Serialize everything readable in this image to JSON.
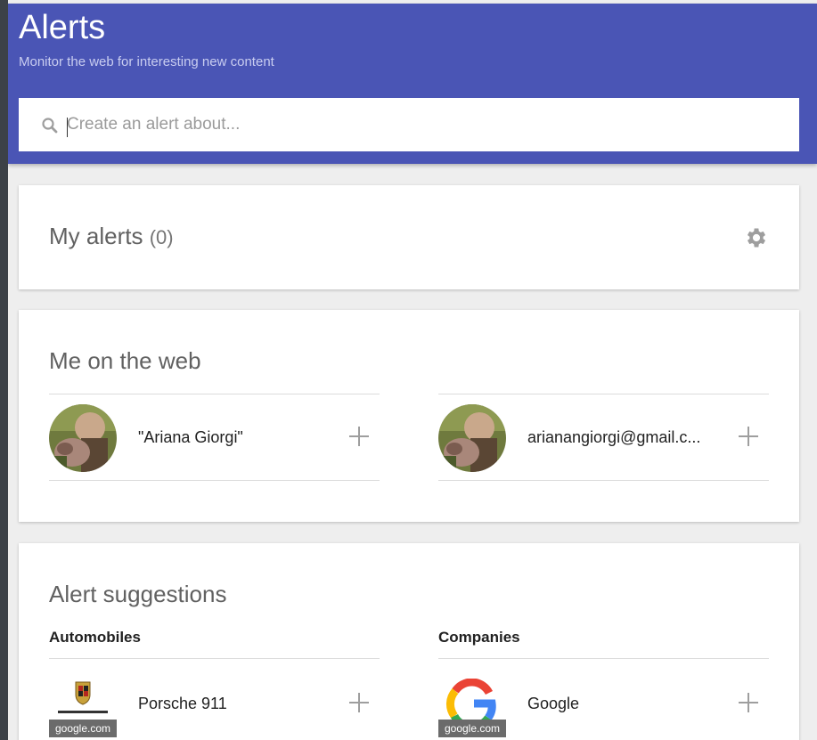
{
  "header": {
    "title": "Alerts",
    "subtitle": "Monitor the web for interesting new content"
  },
  "search": {
    "placeholder": "Create an alert about..."
  },
  "my_alerts": {
    "title": "My alerts",
    "count": "(0)"
  },
  "me_on_web": {
    "title": "Me on the web",
    "items": [
      {
        "label": "\"Ariana Giorgi\""
      },
      {
        "label": "arianangiorgi@gmail.c..."
      }
    ]
  },
  "suggestions": {
    "title": "Alert suggestions",
    "categories": [
      {
        "name": "Automobiles",
        "item": "Porsche 911",
        "source": "google.com"
      },
      {
        "name": "Companies",
        "item": "Google",
        "source": "google.com"
      }
    ]
  },
  "colors": {
    "header_bg": "#4a55b5",
    "page_bg": "#eeeeee"
  }
}
